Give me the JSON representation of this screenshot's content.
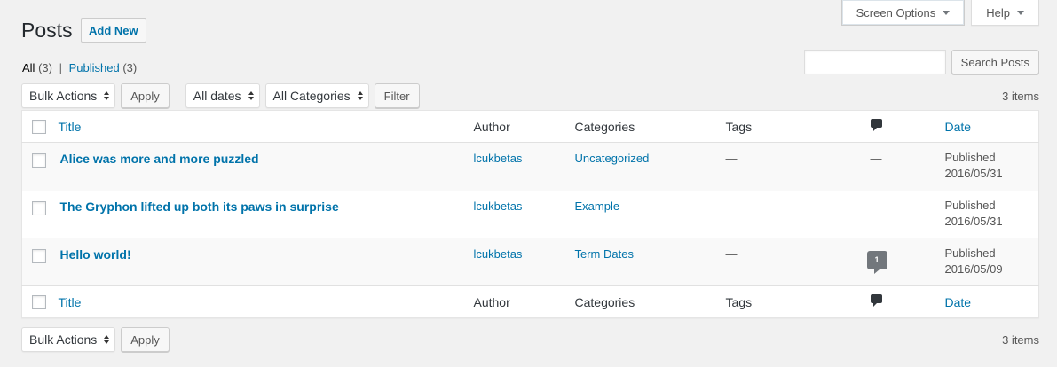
{
  "screen_tabs": {
    "screen_options": "Screen Options",
    "help": "Help"
  },
  "header": {
    "title": "Posts",
    "add_new": "Add New"
  },
  "views": {
    "all_label": "All",
    "all_count": "(3)",
    "separator": "|",
    "published_label": "Published",
    "published_count": "(3)"
  },
  "search": {
    "value": "",
    "button": "Search Posts"
  },
  "tablenav_top": {
    "bulk_actions": "Bulk Actions",
    "apply": "Apply",
    "dates": "All dates",
    "categories": "All Categories",
    "filter": "Filter",
    "items": "3 items"
  },
  "tablenav_bottom": {
    "bulk_actions": "Bulk Actions",
    "apply": "Apply",
    "items": "3 items"
  },
  "columns": {
    "title": "Title",
    "author": "Author",
    "categories": "Categories",
    "tags": "Tags",
    "comments_icon": "comment-icon",
    "date": "Date"
  },
  "rows": [
    {
      "title": "Alice was more and more puzzled",
      "author": "lcukbetas",
      "category": "Uncategorized",
      "tags": "—",
      "comments": "—",
      "status": "Published",
      "date": "2016/05/31"
    },
    {
      "title": "The Gryphon lifted up both its paws in surprise",
      "author": "lcukbetas",
      "category": "Example",
      "tags": "—",
      "comments": "—",
      "status": "Published",
      "date": "2016/05/31"
    },
    {
      "title": "Hello world!",
      "author": "lcukbetas",
      "category": "Term Dates",
      "tags": "—",
      "comments": "1",
      "status": "Published",
      "date": "2016/05/09"
    }
  ],
  "colors": {
    "link": "#0073aa",
    "background": "#f1f1f1",
    "comment_bubble": "#72777c"
  }
}
